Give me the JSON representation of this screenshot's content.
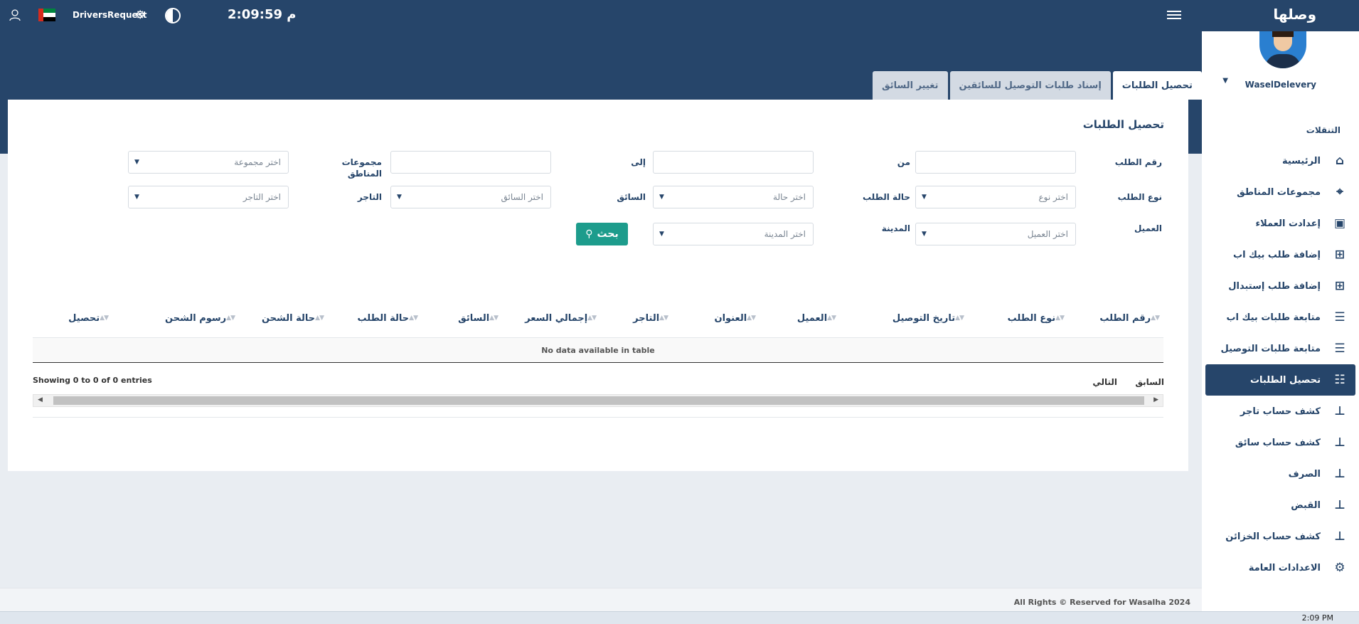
{
  "header": {
    "brand": "وصلها",
    "clock": "2:09:59 م",
    "role": "DriversRequest",
    "colors": {
      "primary": "#26456a",
      "accent": "#1d9c8c"
    }
  },
  "sidebar": {
    "user_name": "WaselDelevery",
    "heading": "التنقلات",
    "items": [
      {
        "label": "الرئيسية",
        "icon": "home-icon"
      },
      {
        "label": "مجموعات المناطق",
        "icon": "crosshair-icon"
      },
      {
        "label": "إعدادت العملاء",
        "icon": "briefcase-icon"
      },
      {
        "label": "إضافة طلب بيك اب",
        "icon": "calendar-plus-icon"
      },
      {
        "label": "إضافة طلب إستبدال",
        "icon": "calendar-plus-icon"
      },
      {
        "label": "متابعة طلبات بيك اب",
        "icon": "database-icon"
      },
      {
        "label": "متابعة طلبات التوصيل",
        "icon": "database-icon"
      },
      {
        "label": "تحصيل الطلبات",
        "icon": "list-icon",
        "active": true
      },
      {
        "label": "كشف حساب تاجر",
        "icon": "sitemap-icon"
      },
      {
        "label": "كشف حساب سائق",
        "icon": "sitemap-icon"
      },
      {
        "label": "الصرف",
        "icon": "sitemap-icon"
      },
      {
        "label": "القبض",
        "icon": "sitemap-icon"
      },
      {
        "label": "كشف حساب الخزائن",
        "icon": "sitemap-icon"
      },
      {
        "label": "الاعدادات العامة",
        "icon": "gears-icon"
      }
    ]
  },
  "tabs": [
    {
      "label": "تحصيل الطلبات",
      "active": true
    },
    {
      "label": "إسناد طلبات التوصيل للسائقين"
    },
    {
      "label": "تغيير السائق"
    }
  ],
  "panel": {
    "title": "تحصيل الطلبات",
    "filters": {
      "order_number_label": "رقم الطلب",
      "from_label": "من",
      "to_label": "إلى",
      "zone_groups_label": "مجموعات المناطق",
      "zone_groups_placeholder": "اختر مجموعة",
      "order_type_label": "نوع الطلب",
      "order_type_placeholder": "اختر نوع",
      "order_status_label": "حالة الطلب",
      "order_status_placeholder": "اختر حالة",
      "driver_label": "السائق",
      "driver_placeholder": "اختر السائق",
      "merchant_label": "التاجر",
      "merchant_placeholder": "اختر التاجر",
      "customer_label": "العميل",
      "customer_placeholder": "اختر العميل",
      "city_label": "المدينة",
      "city_placeholder": "اختر المدينة",
      "search_button": "بحث"
    },
    "table": {
      "columns": [
        "رقم الطلب",
        "نوع الطلب",
        "تاريخ التوصيل",
        "العميل",
        "العنوان",
        "التاجر",
        "إجمالي السعر",
        "السائق",
        "حالة الطلب",
        "حالة الشحن",
        "رسوم الشحن",
        "تحصيل"
      ],
      "empty_message": "No data available in table",
      "info": "Showing 0 to 0 of 0 entries",
      "prev": "السابق",
      "next": "التالي"
    }
  },
  "footer": {
    "text": "All Rights © Reserved for Wasalha 2024"
  },
  "taskbar": {
    "time": "2:09 PM"
  }
}
